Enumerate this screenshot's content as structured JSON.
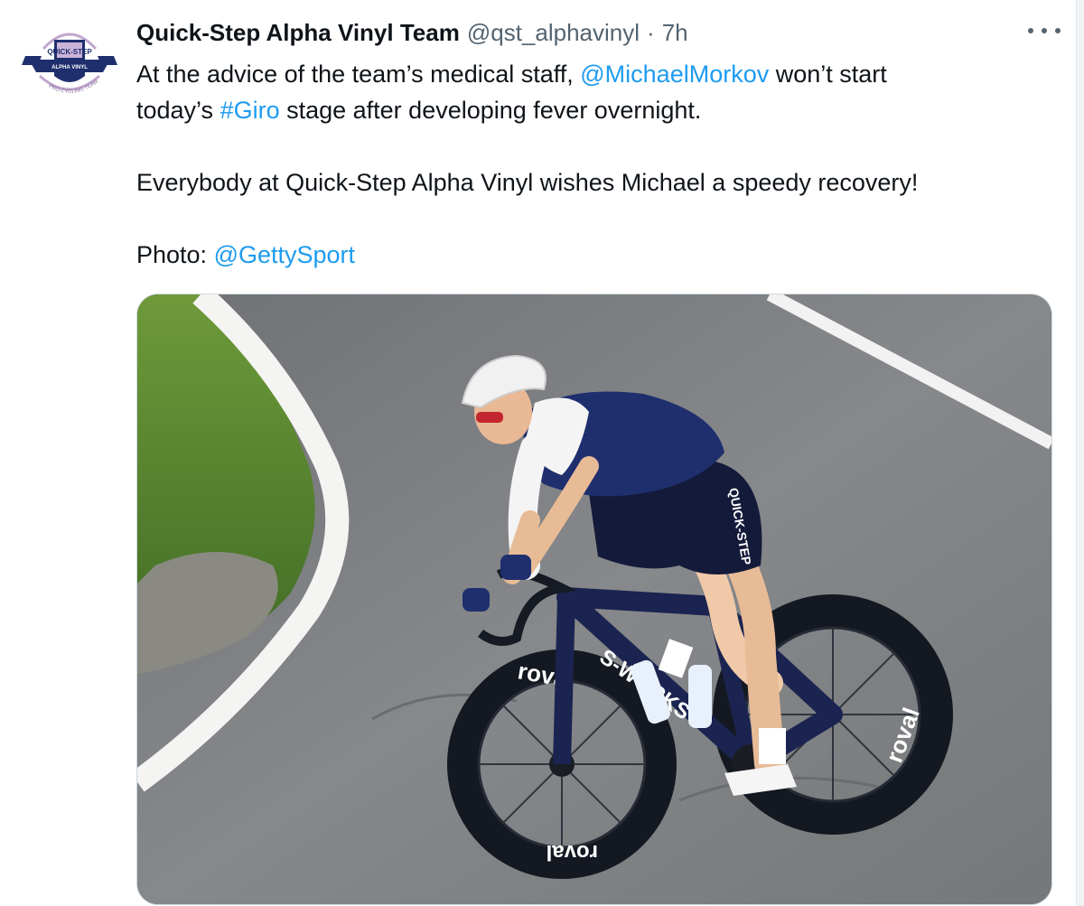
{
  "tweet": {
    "author": {
      "name": "Quick-Step Alpha Vinyl Team",
      "handle": "@qst_alphavinyl",
      "avatar_text_top": "QUICK-STEP",
      "avatar_text_mid": "ALPHA VINYL",
      "avatar_ring_text": "PRO CYCLING TEAM"
    },
    "separator": "·",
    "time": "7h",
    "more_icon": "ellipsis-icon",
    "text": {
      "line1_pre": "At the advice of the team’s medical staff, ",
      "line1_mention": "@MichaelMorkov",
      "line1_post": " won’t start",
      "line2_pre": "today’s ",
      "line2_hashtag": "#Giro",
      "line2_post": " stage after developing fever overnight.",
      "paragraph2": "Everybody at Quick-Step Alpha Vinyl wishes Michael a speedy recovery!",
      "photo_label": "Photo: ",
      "photo_mention": "@GettySport"
    },
    "media": {
      "alt_icon": "cyclist-photo",
      "wheel_brand": "roval",
      "frame_brand": "S-WORKS"
    }
  },
  "colors": {
    "link": "#1d9bf0",
    "text": "#0f1419",
    "muted": "#536471",
    "jersey_blue": "#1f2f6e"
  }
}
